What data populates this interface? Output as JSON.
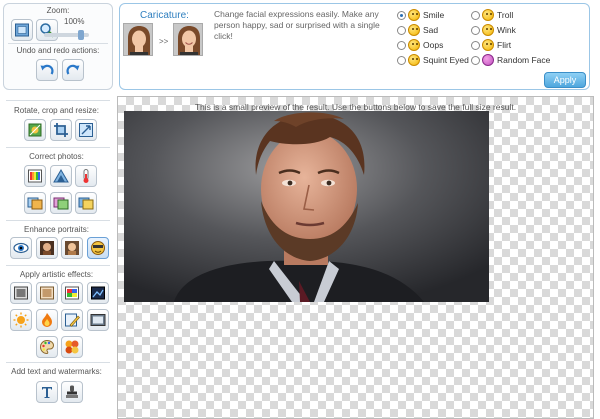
{
  "left": {
    "zoom_title": "Zoom:",
    "zoom_value": "100%",
    "zoom_level": 100,
    "undo_title": "Undo and redo actions:",
    "sections": [
      {
        "title": "Rotate, crop and resize:"
      },
      {
        "title": "Correct photos:"
      },
      {
        "title": "Enhance portraits:"
      },
      {
        "title": "Apply artistic effects:"
      },
      {
        "title": "Add text and watermarks:"
      }
    ]
  },
  "caricature": {
    "title": "Caricature:",
    "arrow": ">>",
    "description": "Change facial expressions easily. Make any person happy, sad or surprised with a single click!",
    "options": [
      {
        "label": "Smile",
        "selected": true
      },
      {
        "label": "Sad",
        "selected": false
      },
      {
        "label": "Oops",
        "selected": false
      },
      {
        "label": "Squint Eyed",
        "selected": false
      },
      {
        "label": "Troll",
        "selected": false
      },
      {
        "label": "Wink",
        "selected": false
      },
      {
        "label": "Flirt",
        "selected": false
      },
      {
        "label": "Random Face",
        "selected": false
      }
    ],
    "apply_label": "Apply"
  },
  "preview": {
    "note": "This is a small preview of the result. Use the buttons below to save the full size result."
  },
  "colors": {
    "accent": "#2f7fbf",
    "apply": "#4fa6dd"
  }
}
